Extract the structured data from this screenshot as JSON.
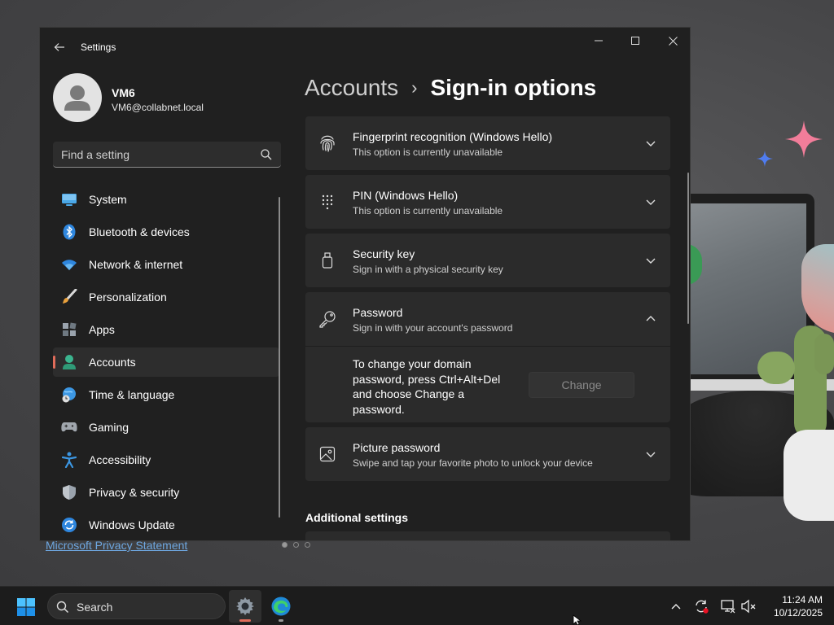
{
  "window": {
    "title": "Settings",
    "back_icon": "arrow-left-icon",
    "controls": [
      "minimize-icon",
      "maximize-icon",
      "close-icon"
    ]
  },
  "user": {
    "name": "VM6",
    "email": "VM6@collabnet.local"
  },
  "search": {
    "placeholder": "Find a setting"
  },
  "nav": {
    "items": [
      {
        "label": "System",
        "icon": "monitor-icon"
      },
      {
        "label": "Bluetooth & devices",
        "icon": "bluetooth-icon"
      },
      {
        "label": "Network & internet",
        "icon": "wifi-icon"
      },
      {
        "label": "Personalization",
        "icon": "paintbrush-icon"
      },
      {
        "label": "Apps",
        "icon": "apps-icon"
      },
      {
        "label": "Accounts",
        "icon": "person-icon",
        "active": true
      },
      {
        "label": "Time & language",
        "icon": "globe-clock-icon"
      },
      {
        "label": "Gaming",
        "icon": "gamepad-icon"
      },
      {
        "label": "Accessibility",
        "icon": "accessibility-icon"
      },
      {
        "label": "Privacy & security",
        "icon": "shield-icon"
      },
      {
        "label": "Windows Update",
        "icon": "update-icon"
      }
    ]
  },
  "breadcrumb": {
    "parent": "Accounts",
    "separator": "›",
    "current": "Sign-in options"
  },
  "cards": [
    {
      "title": "Fingerprint recognition (Windows Hello)",
      "subtitle": "This option is currently unavailable",
      "icon": "fingerprint-icon",
      "expanded": false
    },
    {
      "title": "PIN (Windows Hello)",
      "subtitle": "This option is currently unavailable",
      "icon": "keypad-icon",
      "expanded": false
    },
    {
      "title": "Security key",
      "subtitle": "Sign in with a physical security key",
      "icon": "usb-key-icon",
      "expanded": false
    },
    {
      "title": "Password",
      "subtitle": "Sign in with your account's password",
      "icon": "key-icon",
      "expanded": true,
      "body_text": "To change your domain password, press Ctrl+Alt+Del and choose Change a password.",
      "button_label": "Change"
    },
    {
      "title": "Picture password",
      "subtitle": "Swipe and tap your favorite photo to unlock your device",
      "icon": "picture-icon",
      "expanded": false
    }
  ],
  "additional_settings": {
    "heading": "Additional settings"
  },
  "desktop": {
    "privacy_link": "Microsoft Privacy Statement"
  },
  "taskbar": {
    "search_label": "Search",
    "apps": [
      "settings-gear-icon",
      "edge-browser-icon"
    ],
    "tray_icons": [
      "chevron-up-icon",
      "sync-icon",
      "network-icon",
      "volume-muted-icon"
    ],
    "time": "11:24 AM",
    "date": "10/12/2025"
  },
  "colors": {
    "accent": "#e06c5a",
    "window_bg": "#202020",
    "card_bg": "#2b2b2b",
    "link": "#6ea7e0"
  }
}
